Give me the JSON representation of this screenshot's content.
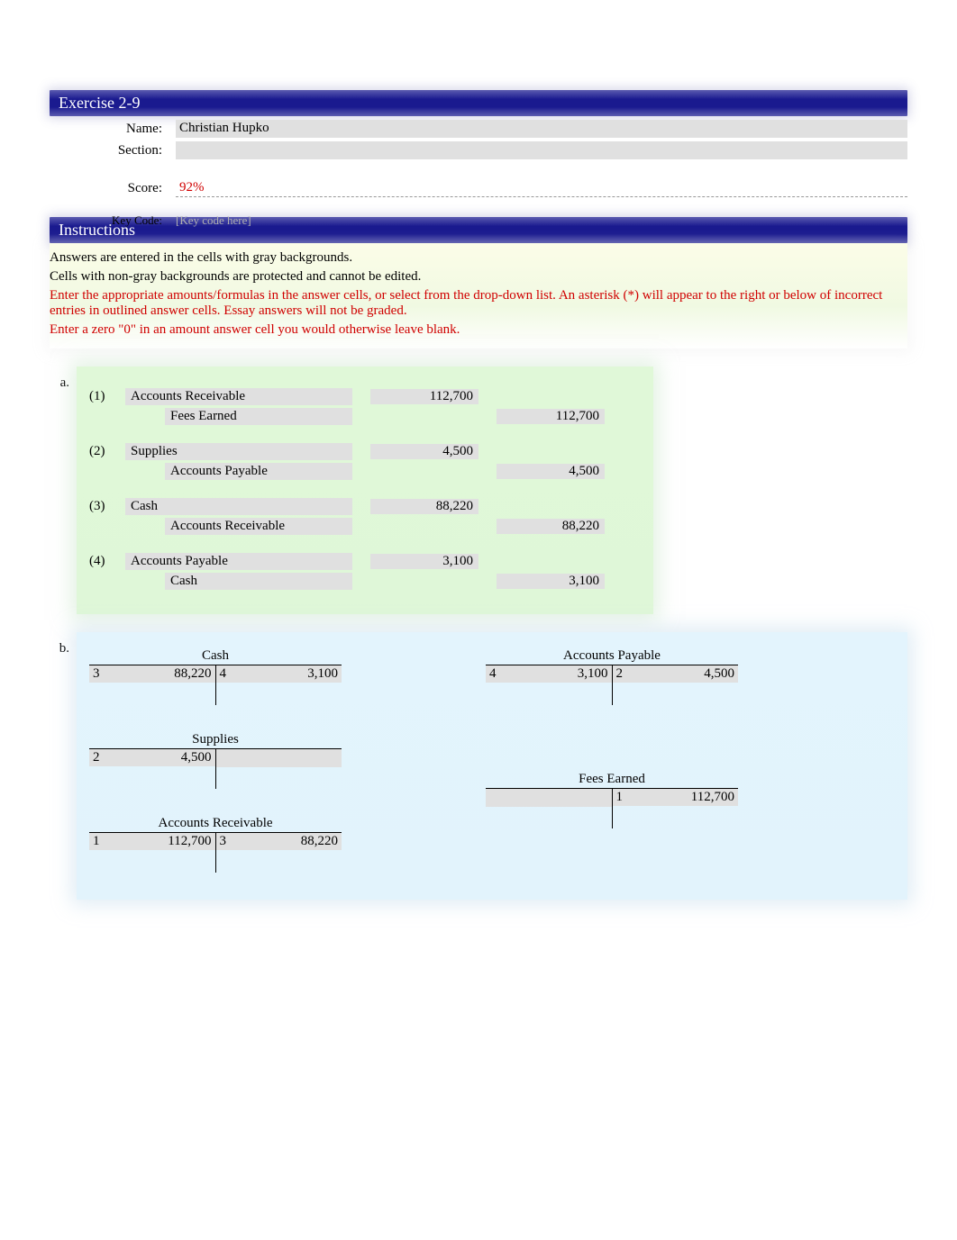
{
  "header": {
    "title": "Exercise 2-9"
  },
  "info": {
    "name_label": "Name:",
    "name_value": "Christian Hupko",
    "section_label": "Section:",
    "section_value": "",
    "score_label": "Score:",
    "score_value": "92%",
    "keycode_label": "Key Code:",
    "keycode_placeholder": "[Key code here]"
  },
  "instructions": {
    "title": "Instructions",
    "line1": "Answers are entered in the cells with gray backgrounds.",
    "line2": "Cells with non-gray backgrounds are protected and cannot be edited.",
    "line3": "Enter the appropriate amounts/formulas in the answer cells, or select from the drop-down list. An asterisk (*) will appear to the right or below of incorrect entries in outlined answer cells. Essay answers will not be graded.",
    "line4": "Enter a zero \"0\" in an amount answer cell you would otherwise leave blank."
  },
  "section_a": {
    "letter": "a.",
    "entries": [
      {
        "num": "(1)",
        "debit_acct": "Accounts Receivable",
        "debit_amt": "112,700",
        "credit_acct": "Fees Earned",
        "credit_amt": "112,700"
      },
      {
        "num": "(2)",
        "debit_acct": "Supplies",
        "debit_amt": "4,500",
        "credit_acct": "Accounts Payable",
        "credit_amt": "4,500"
      },
      {
        "num": "(3)",
        "debit_acct": "Cash",
        "debit_amt": "88,220",
        "credit_acct": "Accounts Receivable",
        "credit_amt": "88,220"
      },
      {
        "num": "(4)",
        "debit_acct": "Accounts Payable",
        "debit_amt": "3,100",
        "credit_acct": "Cash",
        "credit_amt": "3,100"
      }
    ]
  },
  "section_b": {
    "letter": "b.",
    "left_accounts": [
      {
        "title": "Cash",
        "debits": [
          {
            "ref": "3",
            "amt": "88,220"
          }
        ],
        "credits": [
          {
            "ref": "4",
            "amt": "3,100"
          }
        ]
      },
      {
        "title": "Supplies",
        "debits": [
          {
            "ref": "2",
            "amt": "4,500"
          }
        ],
        "credits": []
      },
      {
        "title": "Accounts Receivable",
        "debits": [
          {
            "ref": "1",
            "amt": "112,700"
          }
        ],
        "credits": [
          {
            "ref": "3",
            "amt": "88,220"
          }
        ]
      }
    ],
    "right_accounts": [
      {
        "title": "Accounts Payable",
        "debits": [
          {
            "ref": "4",
            "amt": "3,100"
          }
        ],
        "credits": [
          {
            "ref": "2",
            "amt": "4,500"
          }
        ]
      },
      {
        "title": "Fees Earned",
        "debits": [],
        "credits": [
          {
            "ref": "1",
            "amt": "112,700"
          }
        ]
      }
    ]
  }
}
